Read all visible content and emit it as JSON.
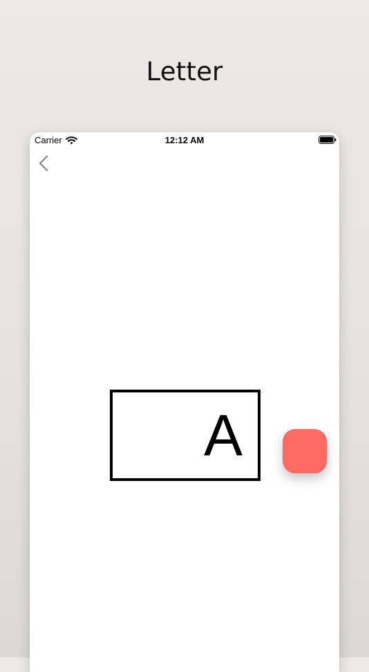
{
  "caption": "Letter",
  "status_bar": {
    "carrier": "Carrier",
    "time": "12:12 AM"
  },
  "icons": {
    "wifi": "wifi-icon",
    "battery": "battery-icon",
    "back": "chevron-left-icon"
  },
  "letter_card": {
    "letter": "A"
  },
  "colors": {
    "action_button": "#ff6a62",
    "back_icon": "#8e8e93"
  }
}
